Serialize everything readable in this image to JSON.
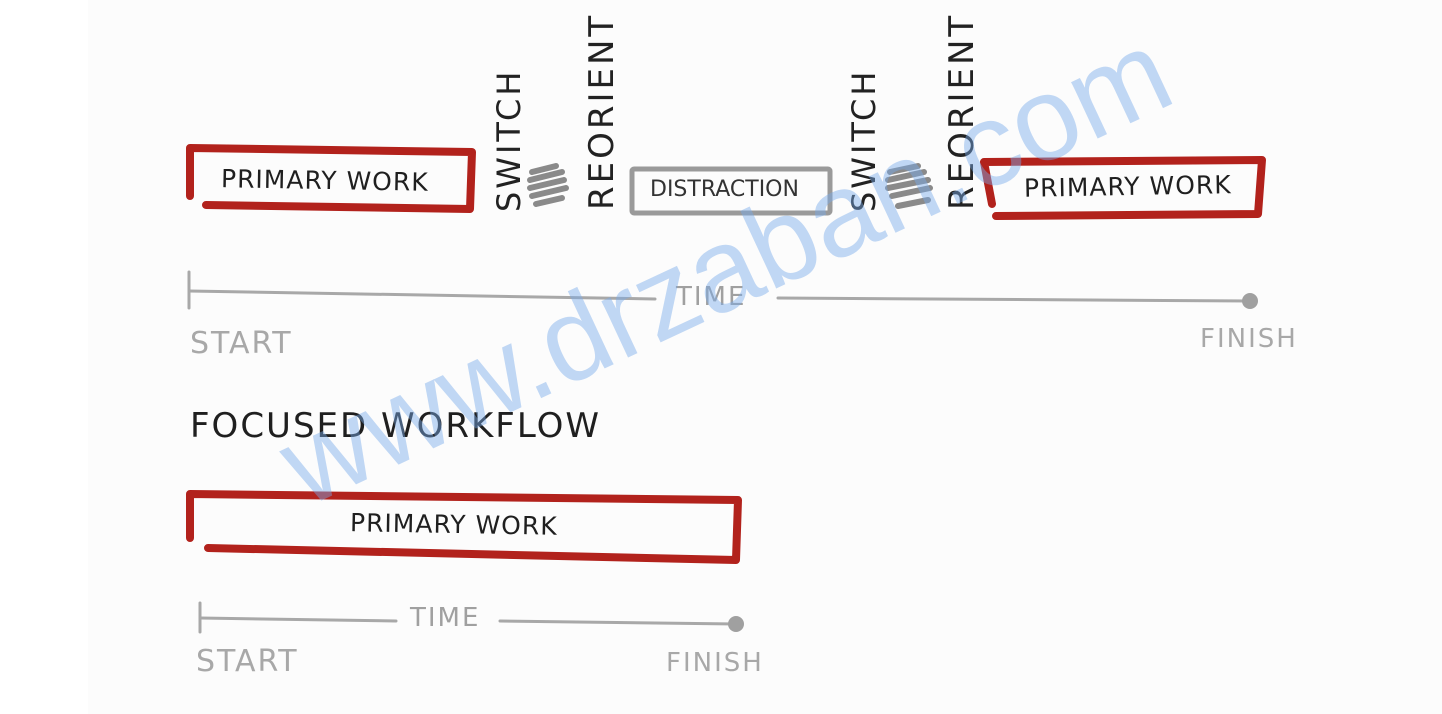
{
  "top_row": {
    "primary_work_1": "PRIMARY WORK",
    "switch_1": "SWITCH",
    "reorient_1": "REORIENT",
    "distraction": "DISTRACTION",
    "switch_2": "SWITCH",
    "reorient_2": "REORIENT",
    "primary_work_2": "PRIMARY WORK"
  },
  "top_timeline": {
    "time_label": "TIME",
    "start_label": "START",
    "finish_label": "FINISH"
  },
  "focused": {
    "heading": "FOCUSED WORKFLOW",
    "primary_work": "PRIMARY WORK",
    "time_label": "TIME",
    "start_label": "START",
    "finish_label": "FINISH"
  },
  "watermark": "www.drzaban.com",
  "colors": {
    "work_box": "#b2221c",
    "distraction_box": "#9a9a9a",
    "timeline": "#a8a8a8",
    "scribble": "#8a8a8a",
    "ink": "#1f1f1f",
    "watermark": "#78aaeb"
  }
}
